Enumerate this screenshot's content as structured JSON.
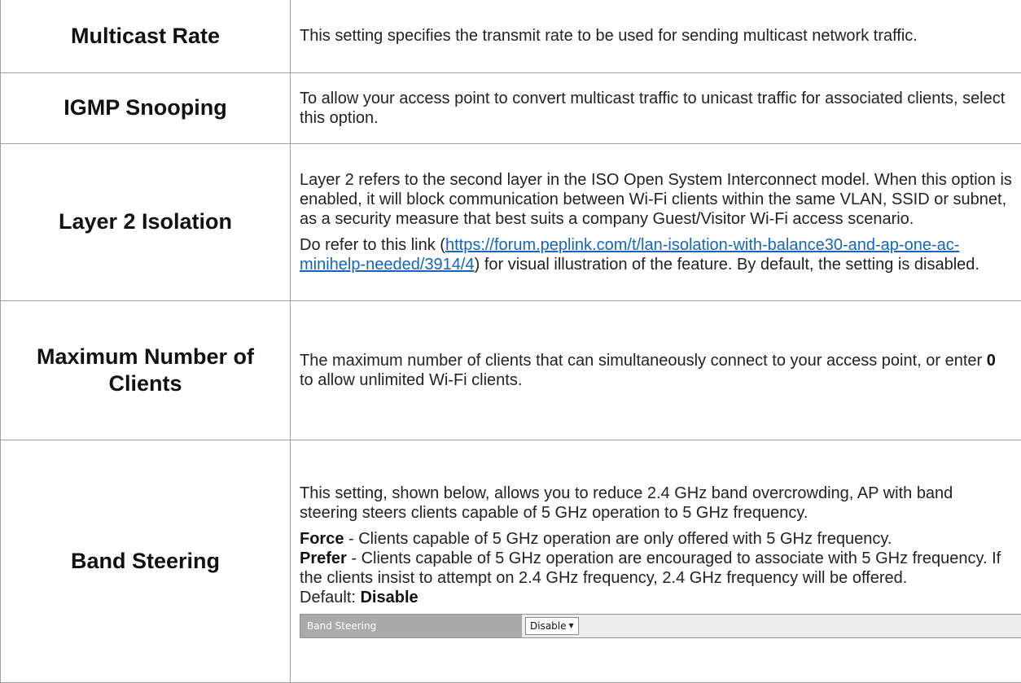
{
  "rows": [
    {
      "term": "Multicast Rate",
      "desc": "This setting specifies the transmit rate to be used for sending multicast network traffic."
    },
    {
      "term": "IGMP Snooping",
      "desc": "To allow your access point to convert multicast traffic to unicast traffic for associated clients, select this option."
    },
    {
      "term": "Layer 2 Isolation",
      "desc_p1": "Layer 2 refers to the second layer in the ISO Open System Interconnect model. When this option is enabled, it will block communication between Wi-Fi clients within the same VLAN, SSID or subnet, as a security measure that best suits a company Guest/Visitor Wi-Fi access scenario.",
      "desc_p2_before": "Do refer to this link (",
      "link_text": "https://forum.peplink.com/t/lan-isolation-with-balance30-and-ap-one-ac-minihelp-needed/3914/4",
      "desc_p2_after": ") for visual illustration of the feature. By default, the setting is disabled."
    },
    {
      "term": "Maximum Number of Clients",
      "desc_before": "The maximum number of clients that can simultaneously connect to your access point, or enter ",
      "desc_bold": "0",
      "desc_after": " to allow unlimited Wi-Fi clients."
    },
    {
      "term": "Band Steering",
      "desc_p1": "This setting, shown below, allows you to reduce 2.4 GHz band overcrowding, AP with band steering steers clients capable of 5 GHz operation to 5 GHz frequency.",
      "force_label": "Force",
      "force_text": " - Clients capable of 5 GHz operation are only offered with 5 GHz frequency.",
      "prefer_label": "Prefer",
      "prefer_text": " - Clients capable of 5 GHz operation are encouraged to associate with 5 GHz frequency. If the clients insist to attempt on 2.4 GHz frequency, 2.4 GHz frequency will be offered.",
      "default_label": "Default: ",
      "default_value": "Disable",
      "form": {
        "label": "Band Steering",
        "selected": "Disable"
      }
    }
  ]
}
